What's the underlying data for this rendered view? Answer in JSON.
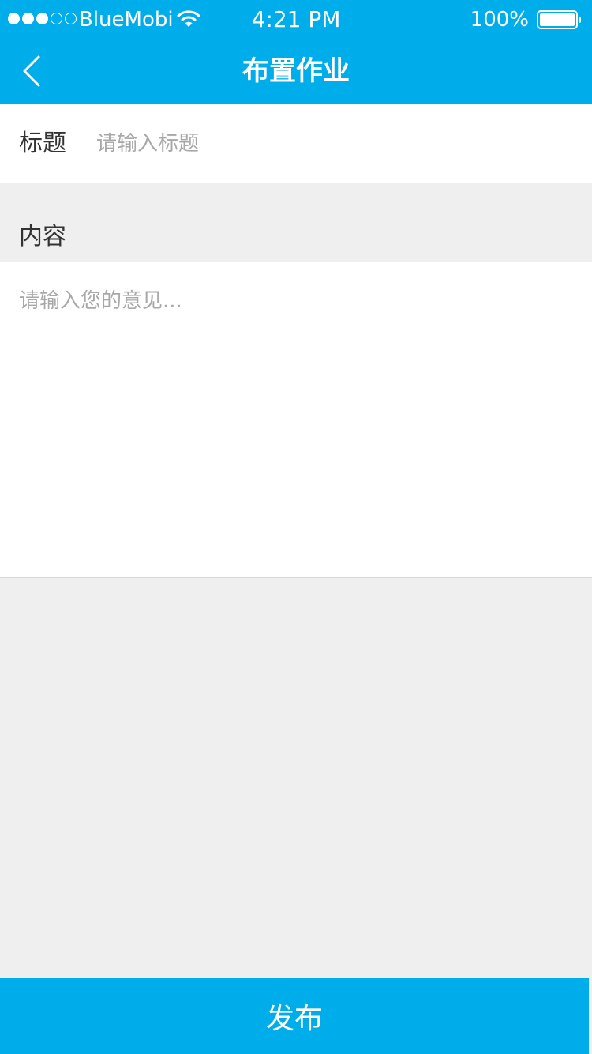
{
  "status_bar": {
    "carrier": "BlueMobi",
    "time": "4:21 PM",
    "battery_percent": "100%",
    "battery_level": 1.0,
    "signal_bars_filled": 3,
    "signal_bars_total": 5
  },
  "nav": {
    "title": "布置作业",
    "back_icon": "chevron-left-icon"
  },
  "form": {
    "title_label": "标题",
    "title_placeholder": "请输入标题",
    "title_value": "",
    "content_label": "内容",
    "content_placeholder": "请输入您的意见...",
    "content_value": ""
  },
  "actions": {
    "publish_label": "发布"
  },
  "colors": {
    "primary": "#00adeb",
    "background": "#efefef",
    "placeholder": "#a8a8a8",
    "label": "#333333"
  }
}
